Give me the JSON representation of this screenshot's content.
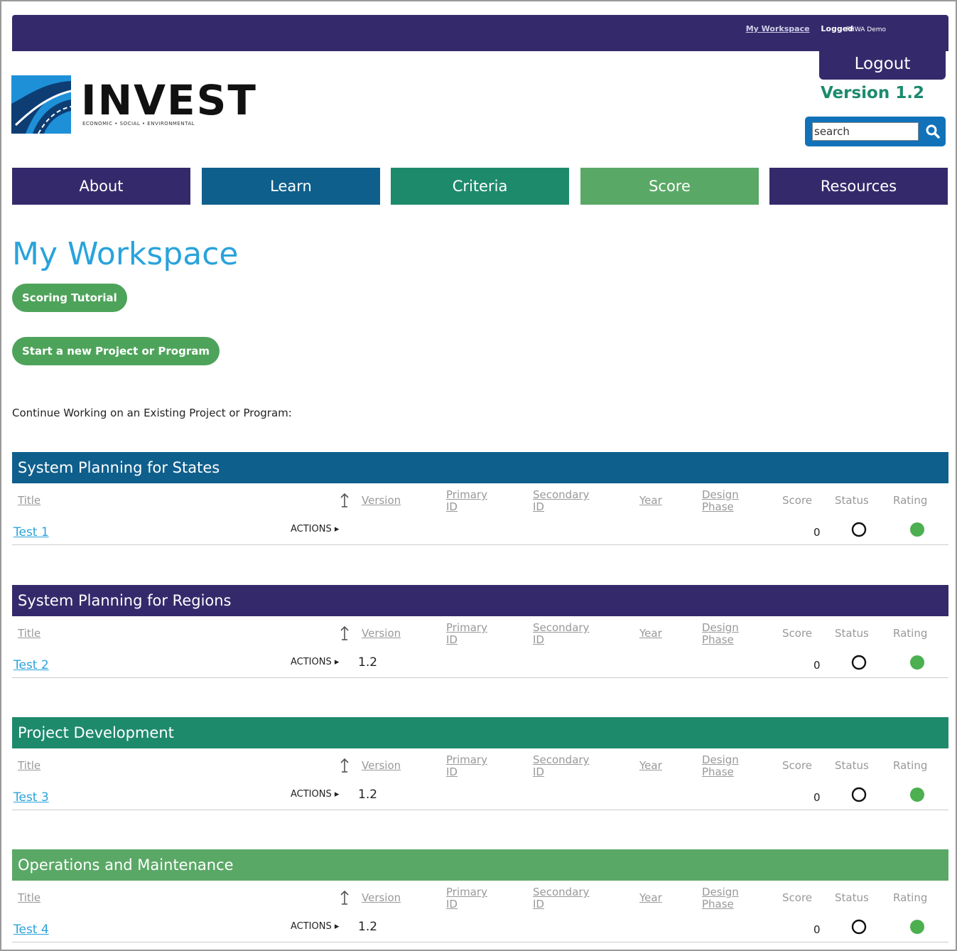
{
  "header": {
    "workspace_link": "My Workspace",
    "logged_in_label": "Logged",
    "user_name": "FHWA Demo",
    "logout_label": "Logout",
    "version": "Version 1.2",
    "search_placeholder": "search"
  },
  "logo": {
    "name": "INVEST",
    "tagline": "ECONOMIC • SOCIAL • ENVIRONMENTAL"
  },
  "nav": [
    {
      "label": "About",
      "color": "#342a6b"
    },
    {
      "label": "Learn",
      "color": "#0f5f8c"
    },
    {
      "label": "Criteria",
      "color": "#1e8a6c"
    },
    {
      "label": "Score",
      "color": "#5aa866"
    },
    {
      "label": "Resources",
      "color": "#342a6b"
    }
  ],
  "page": {
    "title": "My Workspace",
    "tutorial_button": "Scoring Tutorial",
    "new_project_button": "Start a new Project or Program",
    "continue_text": "Continue Working on an Existing Project or Program:"
  },
  "columns": {
    "title": "Title",
    "version": "Version",
    "primary_1": "Primary",
    "primary_2": "ID",
    "secondary_1": "Secondary",
    "secondary_2": "ID",
    "year": "Year",
    "design_1": "Design",
    "design_2": "Phase",
    "score": "Score",
    "status": "Status",
    "rating": "Rating"
  },
  "sections": [
    {
      "name": "System Planning for States",
      "color": "#0f5f8c",
      "row": {
        "title": "Test 1",
        "actions": "ACTIONS ▸",
        "version": "",
        "score": "0"
      }
    },
    {
      "name": "System Planning for Regions",
      "color": "#342a6b",
      "row": {
        "title": "Test 2",
        "actions": "ACTIONS ▸",
        "version": "1.2",
        "score": "0"
      }
    },
    {
      "name": "Project Development",
      "color": "#1e8a6c",
      "row": {
        "title": "Test 3",
        "actions": "ACTIONS ▸",
        "version": "1.2",
        "score": "0"
      }
    },
    {
      "name": "Operations and Maintenance",
      "color": "#5aa866",
      "row": {
        "title": "Test 4",
        "actions": "ACTIONS ▸",
        "version": "1.2",
        "score": "0"
      }
    }
  ],
  "icons": {
    "status": "open-circle-icon",
    "rating": "green-dot-icon",
    "rating_color": "#4caf50",
    "sort": "sort-arrow-icon",
    "search": "search-icon"
  }
}
